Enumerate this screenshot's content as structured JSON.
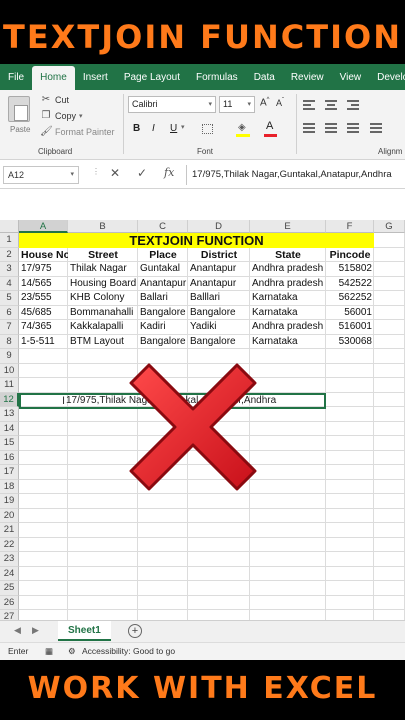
{
  "banner": {
    "top": "TEXTJOIN FUNCTION",
    "bottom": "WORK WITH EXCEL"
  },
  "ribbon_tabs": [
    "File",
    "Home",
    "Insert",
    "Page Layout",
    "Formulas",
    "Data",
    "Review",
    "View",
    "Develope"
  ],
  "active_tab": "Home",
  "clipboard": {
    "paste": "Paste",
    "cut": "Cut",
    "copy": "Copy",
    "format_painter": "Format Painter",
    "label": "Clipboard"
  },
  "font": {
    "family": "Calibri",
    "size": "11",
    "label": "Font",
    "bold": "B",
    "italic": "I",
    "underline": "U"
  },
  "alignment_label": "Alignm",
  "formula_bar": {
    "name_box": "A12",
    "fx": "fx",
    "formula": "17/975,Thilak Nagar,Guntakal,Anatapur,Andhra"
  },
  "columns": [
    "A",
    "B",
    "C",
    "D",
    "E",
    "F",
    "G"
  ],
  "rows": [
    "1",
    "2",
    "3",
    "4",
    "5",
    "6",
    "7",
    "8",
    "9",
    "10",
    "11",
    "12",
    "13",
    "14",
    "15",
    "16",
    "17",
    "18",
    "19",
    "20",
    "21",
    "22",
    "23",
    "24",
    "25",
    "26",
    "27"
  ],
  "sheet_title": "TEXTJOIN FUNCTION",
  "table": {
    "headers": [
      "House No",
      "Street",
      "Place",
      "District",
      "State",
      "Pincode"
    ],
    "rows": [
      [
        "17/975",
        "Thilak Nagar",
        "Guntakal",
        "Anantapur",
        "Andhra pradesh",
        "515802"
      ],
      [
        "14/565",
        "Housing Board",
        "Anantapur",
        "Anantapur",
        "Andhra pradesh",
        "542522"
      ],
      [
        "23/555",
        "KHB Colony",
        "Ballari",
        "Balllari",
        "Karnataka",
        "562252"
      ],
      [
        "45/685",
        "Bommanahalli",
        "Bangalore",
        "Bangalore",
        "Karnataka",
        "56001"
      ],
      [
        "74/365",
        "Kakkalapalli",
        "Kadiri",
        "Yadiki",
        "Andhra pradesh",
        "516001"
      ],
      [
        "1-5-511",
        "BTM Layout",
        "Bangalore",
        "Bangalore",
        "Karnataka",
        "530068"
      ]
    ]
  },
  "active_cell_text": "17/975,Thilak Nagar,Guntakal,Anatapur,Andhra",
  "sheet_tab": "Sheet1",
  "status": {
    "mode": "Enter",
    "accessibility": "Accessibility: Good to go"
  },
  "colors": {
    "excel_green": "#217346",
    "banner_orange": "#ff7a1a",
    "title_yellow": "#ffff00",
    "x_red": "#e8202a"
  },
  "icons": [
    "cut-icon",
    "copy-icon",
    "format-painter-icon",
    "paste-icon",
    "cancel-icon",
    "enter-icon",
    "fx-icon",
    "add-sheet-icon",
    "red-x-icon"
  ]
}
